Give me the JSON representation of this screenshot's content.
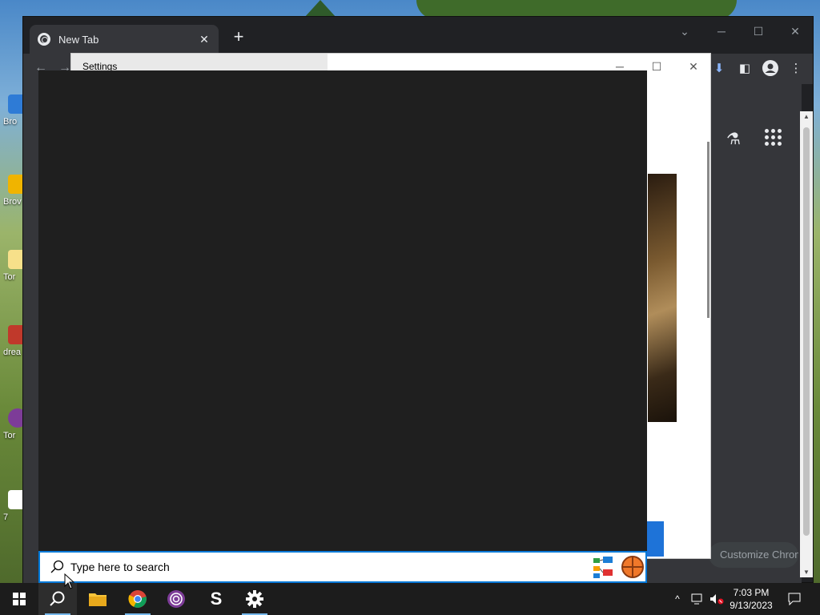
{
  "desktop": {
    "icons": [
      {
        "label": "Bro",
        "color": "#2e7bd6"
      },
      {
        "label": "Brov Tem",
        "color": "#f0b400"
      },
      {
        "label": "Tor",
        "color": "#f7e08a"
      },
      {
        "label": "drea",
        "color": "#c0392b"
      },
      {
        "label": "Tor",
        "color": "#7d3c98"
      },
      {
        "label": "7",
        "color": "#ffffff"
      }
    ]
  },
  "chrome": {
    "tab_title": "New Tab",
    "tab_close": "✕",
    "new_tab": "+",
    "customize_label": "Customize Chrome"
  },
  "settings_window": {
    "title": "Settings"
  },
  "search": {
    "placeholder": "Type here to search"
  },
  "taskbar": {
    "time": "7:03 PM",
    "date": "9/13/2023",
    "apps": [
      "start",
      "search",
      "file-explorer",
      "chrome",
      "tor-browser",
      "s-app",
      "settings"
    ]
  },
  "colors": {
    "taskbar_bg": "#1c1c1c",
    "accent": "#0078d7",
    "chrome_dark": "#202124"
  }
}
